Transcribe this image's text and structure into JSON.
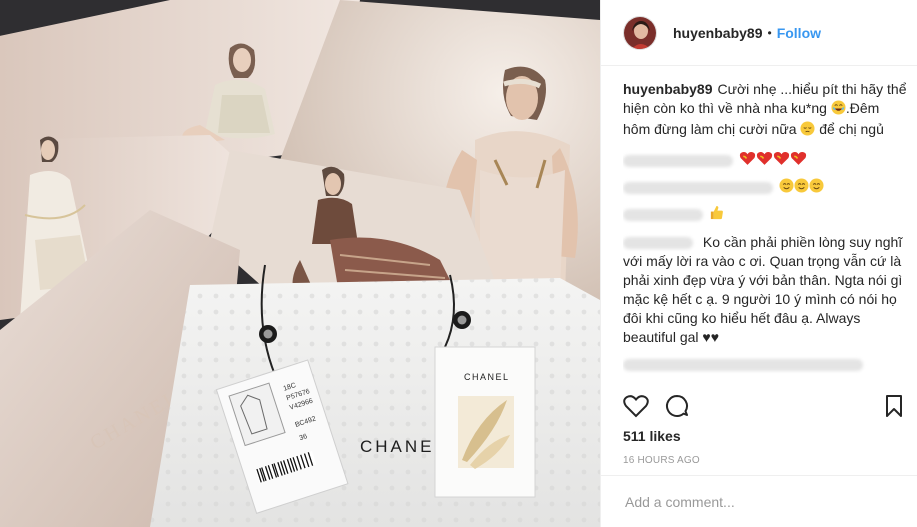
{
  "post": {
    "username": "huyenbaby89",
    "separator": "•",
    "follow_label": "Follow",
    "photo_text": {
      "brand": "CHANEL",
      "tag_brand": "CHANEL",
      "card_brand": "CHANEL",
      "tag_code1": "18C",
      "tag_code2": "P57676",
      "tag_code3": "V42966",
      "tag_code4": "BC492",
      "tag_size": "36"
    }
  },
  "caption": {
    "username": "huyenbaby89",
    "text_part1": "Cười nhẹ ...hiểu pít thi hãy thể hiện còn ko thì về nhà nha ku*ng",
    "text_part2": ".Đêm hôm đừng làm chị cười nữa",
    "text_part3": "để chị ngủ"
  },
  "comments": [
    {
      "name_hidden": true,
      "text": "",
      "emojis": [
        "red-heart-icon",
        "red-heart-icon",
        "red-heart-icon",
        "red-heart-icon"
      ]
    },
    {
      "name_hidden": true,
      "text": "",
      "emojis": [
        "smile-icon",
        "smile-icon",
        "smile-icon"
      ]
    },
    {
      "name_hidden": true,
      "text": "",
      "emojis": [
        "thumbs-up-icon"
      ]
    },
    {
      "name_hidden": true,
      "text": "Ko cần phải phiền lòng suy nghĩ với mấy lời ra vào c ơi. Quan trọng vẫn cứ là phải xinh đẹp vừa ý với bản thân. Ngta nói gì mặc kệ hết c ạ. 9 người 10 ý mình có nói họ đôi khi cũng ko hiểu hết đâu ạ. Always beautiful gal ♥♥"
    }
  ],
  "likes_text": "511 likes",
  "timestamp": "16 HOURS AGO",
  "add_comment_placeholder": "Add a comment...",
  "colors": {
    "link": "#3897f0",
    "muted": "#999999",
    "text": "#262626"
  }
}
